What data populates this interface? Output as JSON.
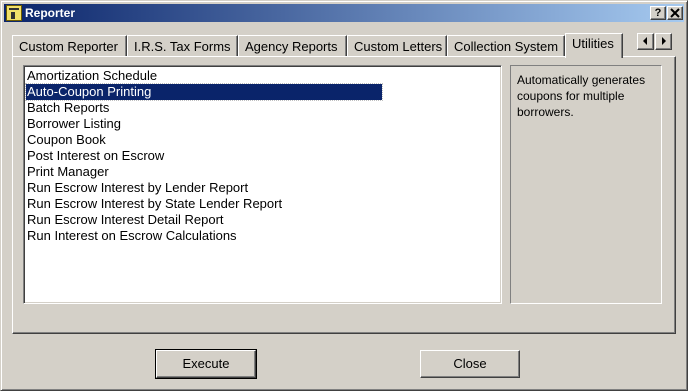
{
  "window": {
    "title": "Reporter",
    "help_label": "?",
    "close_label": "x"
  },
  "tabs": [
    {
      "label": "Custom Reporter"
    },
    {
      "label": "I.R.S. Tax Forms"
    },
    {
      "label": "Agency Reports"
    },
    {
      "label": "Custom Letters"
    },
    {
      "label": "Collection System"
    },
    {
      "label": "Utilities",
      "active": true
    }
  ],
  "list": {
    "items": [
      "Amortization Schedule",
      "Auto-Coupon Printing",
      "Batch Reports",
      "Borrower Listing",
      "Coupon Book",
      "Post Interest on Escrow",
      "Print Manager",
      "Run Escrow Interest by Lender Report",
      "Run Escrow Interest by State Lender Report",
      "Run Escrow Interest Detail Report",
      "Run Interest on Escrow Calculations"
    ],
    "selected": "Auto-Coupon Printing"
  },
  "description": "Automatically generates coupons for multiple borrowers.",
  "buttons": {
    "execute": "Execute",
    "close": "Close"
  },
  "colors": {
    "selection": "#0a246a",
    "face": "#d4d0c8",
    "title_start": "#0a246a",
    "title_end": "#a6caf0"
  },
  "icons": {
    "app": "reporter-app-icon",
    "tab_left": "arrow-left-icon",
    "tab_right": "arrow-right-icon"
  }
}
